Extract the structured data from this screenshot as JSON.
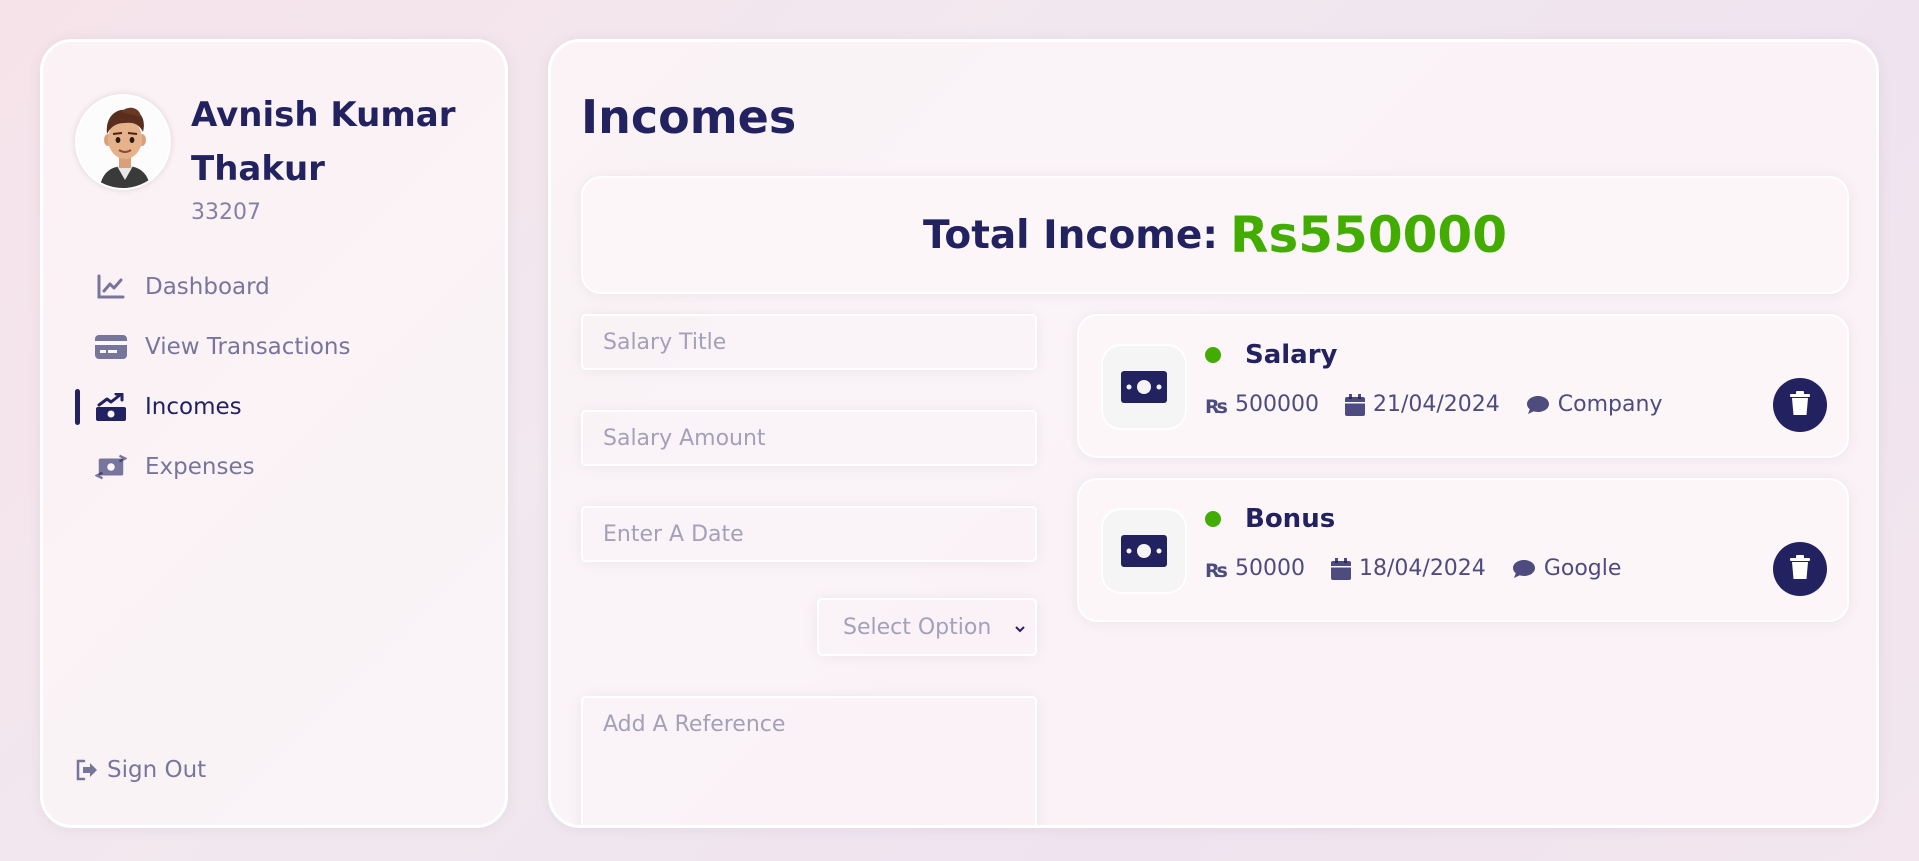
{
  "user": {
    "name": "Avnish Kumar Thakur",
    "id": "33207"
  },
  "menu": [
    {
      "label": "Dashboard",
      "icon": "chart-line-icon",
      "active": false
    },
    {
      "label": "View Transactions",
      "icon": "credit-card-icon",
      "active": false
    },
    {
      "label": "Incomes",
      "icon": "money-bill-trend-up-icon",
      "active": true
    },
    {
      "label": "Expenses",
      "icon": "money-bill-transfer-icon",
      "active": false
    }
  ],
  "signout_label": "Sign Out",
  "page": {
    "title": "Incomes",
    "total_label": "Total Income:",
    "total_amount": "Rs550000"
  },
  "form": {
    "title_placeholder": "Salary Title",
    "amount_placeholder": "Salary Amount",
    "date_placeholder": "Enter A Date",
    "select_value": "Select Option",
    "reference_placeholder": "Add A Reference"
  },
  "incomes": [
    {
      "title": "Salary",
      "amount": "500000",
      "date": "21/04/2024",
      "description": "Company"
    },
    {
      "title": "Bonus",
      "amount": "50000",
      "date": "18/04/2024",
      "description": "Google"
    }
  ],
  "colors": {
    "primary": "#222260",
    "green": "#42AD00"
  }
}
